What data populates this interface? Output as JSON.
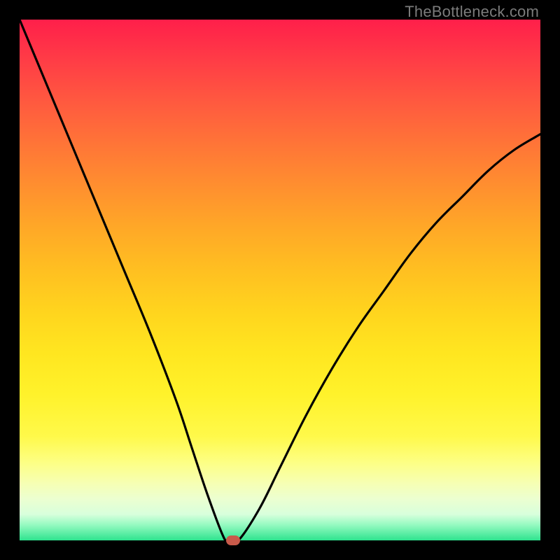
{
  "watermark": "TheBottleneck.com",
  "chart_data": {
    "type": "line",
    "title": "",
    "xlabel": "",
    "ylabel": "",
    "xlim": [
      0,
      100
    ],
    "ylim": [
      0,
      100
    ],
    "grid": false,
    "background_gradient": {
      "direction": "vertical",
      "stops": [
        {
          "pos": 0,
          "color": "#ff1f4a"
        },
        {
          "pos": 50,
          "color": "#ffc820"
        },
        {
          "pos": 85,
          "color": "#fdff84"
        },
        {
          "pos": 100,
          "color": "#2ee38e"
        }
      ]
    },
    "series": [
      {
        "name": "bottleneck-curve",
        "x": [
          0,
          5,
          10,
          15,
          20,
          25,
          30,
          33,
          36,
          39,
          40,
          42,
          46,
          50,
          55,
          60,
          65,
          70,
          75,
          80,
          85,
          90,
          95,
          100
        ],
        "y": [
          100,
          88,
          76,
          64,
          52,
          40,
          27,
          18,
          9,
          1,
          0,
          0,
          6,
          14,
          24,
          33,
          41,
          48,
          55,
          61,
          66,
          71,
          75,
          78
        ]
      }
    ],
    "marker": {
      "x": 41,
      "y": 0,
      "color": "#c85a4a"
    },
    "frame": {
      "border_px": 28,
      "color": "#000000"
    }
  }
}
